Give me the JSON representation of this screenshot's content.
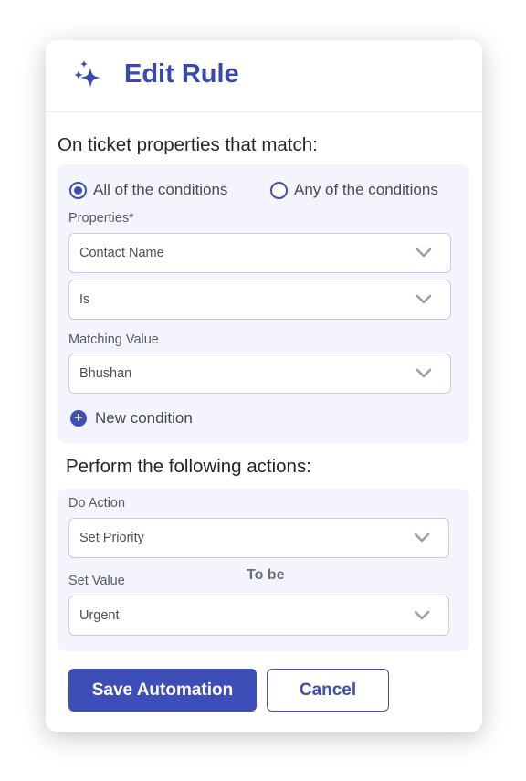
{
  "header": {
    "title": "Edit Rule",
    "icon": "sparkles-icon"
  },
  "conditions": {
    "heading": "On ticket properties that match:",
    "match_options": [
      {
        "label": "All of the conditions",
        "selected": true
      },
      {
        "label": "Any of the conditions",
        "selected": false
      }
    ],
    "properties_label": "Properties*",
    "property_value": "Contact Name",
    "operator_value": "Is",
    "matching_label": "Matching Value",
    "matching_value": "Bhushan",
    "new_condition_label": "New condition"
  },
  "actions": {
    "heading": "Perform the following actions:",
    "do_action_label": "Do Action",
    "do_action_value": "Set Priority",
    "to_be_label": "To be",
    "set_value_label": "Set Value",
    "set_value_value": "Urgent"
  },
  "footer": {
    "save_label": "Save Automation",
    "cancel_label": "Cancel"
  },
  "colors": {
    "accent": "#3d4eb8",
    "title": "#3a49b0",
    "panel": "#f4f5fc"
  }
}
